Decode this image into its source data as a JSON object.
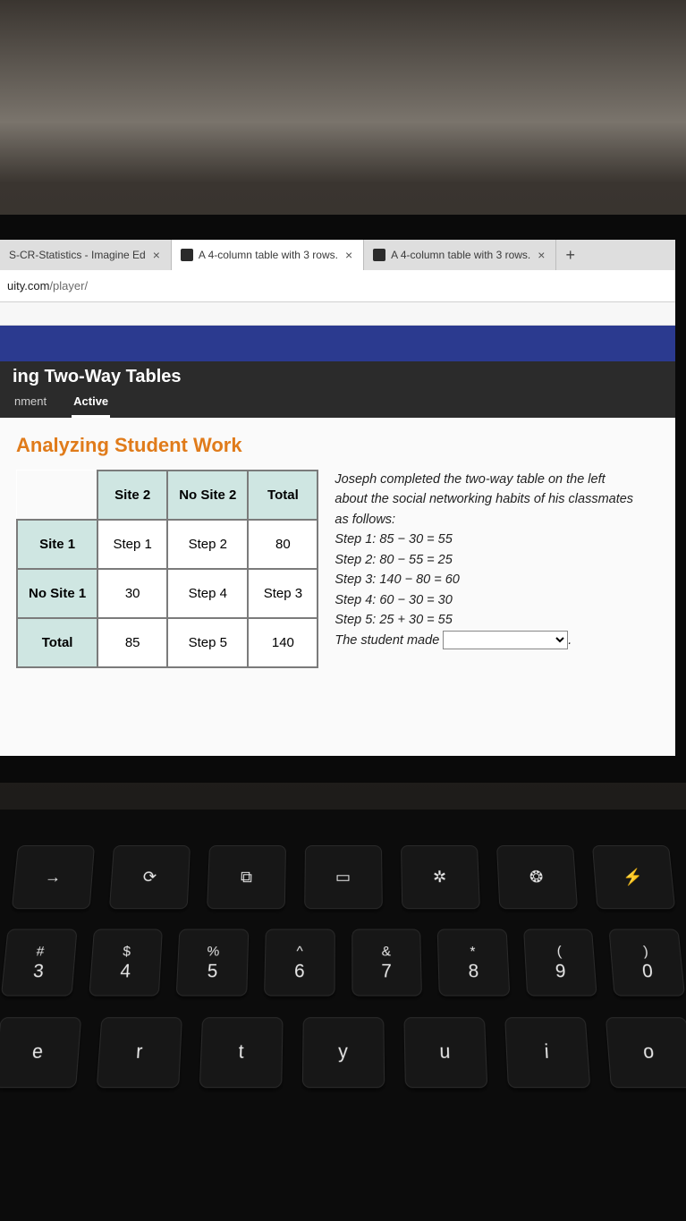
{
  "tabs": [
    {
      "title": "S-CR-Statistics - Imagine Ed",
      "active": false
    },
    {
      "title": "A 4-column table with 3 rows.",
      "active": true
    },
    {
      "title": "A 4-column table with 3 rows.",
      "active": false
    }
  ],
  "address": {
    "prefix": "uity.com",
    "path": "/player/"
  },
  "lesson": {
    "title": "ing Two-Way Tables",
    "tabs": [
      "nment",
      "Active"
    ],
    "active_tab": "Active"
  },
  "section_title": "Analyzing Student Work",
  "table": {
    "col_headers": [
      "Site 2",
      "No Site 2",
      "Total"
    ],
    "rows": [
      {
        "header": "Site 1",
        "cells": [
          "Step 1",
          "Step 2",
          "80"
        ]
      },
      {
        "header": "No Site 1",
        "cells": [
          "30",
          "Step 4",
          "Step 3"
        ]
      },
      {
        "header": "Total",
        "cells": [
          "85",
          "Step 5",
          "140"
        ]
      }
    ]
  },
  "explain": {
    "lead": "Joseph completed the two-way table on the left about the social networking habits of his classmates as follows:",
    "steps": [
      "Step 1: 85 − 30 = 55",
      "Step 2: 80 − 55 = 25",
      "Step 3: 140 − 80 = 60",
      "Step 4: 60 − 30 = 30",
      "Step 5: 25 + 30 = 55"
    ],
    "prompt_prefix": "The student made",
    "select_value": ""
  },
  "chart_data": {
    "type": "table",
    "title": "Two-way table: Site 1 vs Site 2",
    "col_labels": [
      "Site 2",
      "No Site 2",
      "Total"
    ],
    "row_labels": [
      "Site 1",
      "No Site 1",
      "Total"
    ],
    "given_values": {
      "Site 1,Total": 80,
      "No Site 1,Site 2": 30,
      "Total,Site 2": 85,
      "Total,Total": 140
    },
    "computed_steps": {
      "Step 1": {
        "cell": "Site 1,Site 2",
        "expr": "85 − 30",
        "value": 55
      },
      "Step 2": {
        "cell": "Site 1,No Site 2",
        "expr": "80 − 55",
        "value": 25
      },
      "Step 3": {
        "cell": "No Site 1,Total",
        "expr": "140 − 80",
        "value": 60
      },
      "Step 4": {
        "cell": "No Site 1,No Site 2",
        "expr": "60 − 30",
        "value": 30
      },
      "Step 5": {
        "cell": "Total,No Site 2",
        "expr": "25 + 30",
        "value": 55
      }
    }
  },
  "keyboard": {
    "fn_row": [
      "→",
      "⟳",
      "⧉",
      "▭",
      "✲",
      "❂",
      "⚡"
    ],
    "num_row": [
      {
        "u": "#",
        "l": "3"
      },
      {
        "u": "$",
        "l": "4"
      },
      {
        "u": "%",
        "l": "5"
      },
      {
        "u": "^",
        "l": "6"
      },
      {
        "u": "&",
        "l": "7"
      },
      {
        "u": "*",
        "l": "8"
      },
      {
        "u": "(",
        "l": "9"
      },
      {
        "u": ")",
        "l": "0"
      }
    ],
    "letter_row": [
      "e",
      "r",
      "t",
      "y",
      "u",
      "i",
      "o"
    ]
  }
}
